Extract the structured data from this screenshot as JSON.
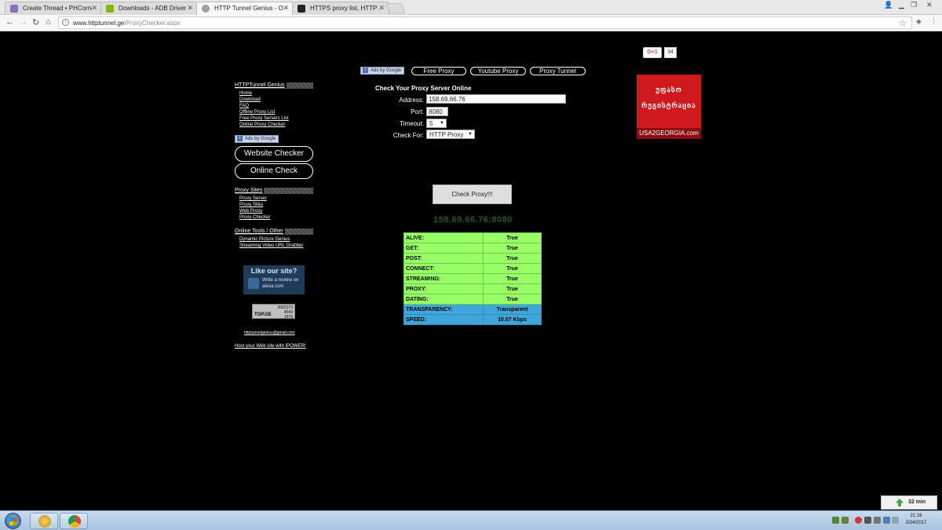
{
  "browser": {
    "tabs": [
      {
        "label": "Create Thread • PHCorner",
        "favicon": "#8a6fc0"
      },
      {
        "label": "Downloads - ADB Driver",
        "favicon": "#7fba00"
      },
      {
        "label": "HTTP Tunnel Genius - Online",
        "favicon": "#1a1a1a"
      },
      {
        "label": "HTTPS proxy list, HTTP proxy",
        "favicon": "#222"
      }
    ],
    "url_host": "www.httptunnel.ge",
    "url_path": "/ProxyChecker.aspx"
  },
  "social": {
    "gplus_label": "G+1",
    "gplus_count": "34"
  },
  "top_nav": {
    "ads_label": "Ads by Google",
    "links": [
      "Free Proxy",
      "Youtube Proxy",
      "Proxy Tunnel"
    ]
  },
  "ad_georgia": {
    "line1": "უფასო",
    "line2": "რეგისტრაცია",
    "url": "USA2GEORGIA.com"
  },
  "sidebar": {
    "section1": {
      "title": "HTTPTunnel Genius",
      "links": [
        "Home",
        "Download",
        "FAQ",
        "Offline Proxy List",
        "Free Proxy Servers List",
        "Online Proxy Checker"
      ]
    },
    "ads_label": "Ads by Google",
    "button1": "Website Checker",
    "button2": "Online Check",
    "section2": {
      "title": "Proxy Sites",
      "links": [
        "Proxy Server",
        "Proxy Sites",
        "Web Proxy",
        "Proxy Checker"
      ]
    },
    "section3": {
      "title": "Online Tools / Other",
      "links": [
        "Dynamic Picture Genius",
        "Streaming Video URL Grabber"
      ]
    },
    "alexa": {
      "title": "Like our site?",
      "text": "Write a review on alexa.com"
    },
    "topge": {
      "label": "TOP.GE",
      "n1": "2602173",
      "n2": "4543",
      "n3": "1575"
    },
    "email": "httptunnelgenius@gmail.com",
    "host_link": "Host your Web site with IPOWER!"
  },
  "form": {
    "title": "Check Your Proxy Server Online",
    "address_label": "Address:",
    "address_value": "158.69.66.76",
    "port_label": "Port:",
    "port_value": "8080",
    "timeout_label": "Timeout:",
    "timeout_value": "5",
    "checkfor_label": "Check For:",
    "checkfor_value": "HTTP Proxy",
    "button": "Check Proxy!!!",
    "result_address": "158.69.66.76:8080"
  },
  "results": [
    {
      "label": "ALIVE:",
      "value": "True",
      "type": "green"
    },
    {
      "label": "GET:",
      "value": "True",
      "type": "green"
    },
    {
      "label": "POST:",
      "value": "True",
      "type": "green"
    },
    {
      "label": "CONNECT:",
      "value": "True",
      "type": "green"
    },
    {
      "label": "STREAMING:",
      "value": "True",
      "type": "green"
    },
    {
      "label": "PROXY:",
      "value": "True",
      "type": "green"
    },
    {
      "label": "DATING:",
      "value": "True",
      "type": "green"
    },
    {
      "label": "TRANSPARENCY:",
      "value": "Transparent",
      "type": "blue"
    },
    {
      "label": "SPEED:",
      "value": "10.07 Kbps",
      "type": "blue"
    }
  ],
  "download": {
    "label": "32 min"
  },
  "taskbar": {
    "time": "21:16",
    "date": "2/24/2017"
  }
}
